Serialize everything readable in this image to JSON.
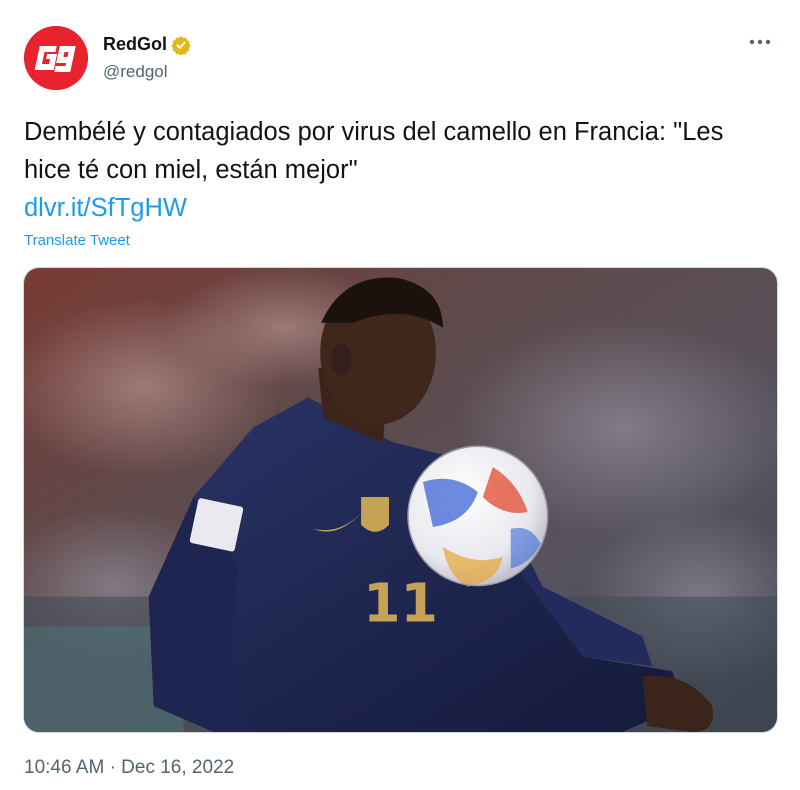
{
  "author": {
    "display_name": "RedGol",
    "handle": "@redgol",
    "verified": true,
    "avatar_icon": "redgol-logo-icon",
    "avatar_color": "#e8232e"
  },
  "tweet": {
    "text": "Dembélé y contagiados por virus del camello en Francia: \"Les hice té con miel, están mejor\"",
    "link": "dlvr.it/SfTgHW",
    "translate_label": "Translate Tweet",
    "image_subject": "soccer player in blue kit controlling a ball",
    "jersey_number": "11"
  },
  "meta": {
    "time": "10:46 AM",
    "separator": "·",
    "date": "Dec 16, 2022"
  },
  "colors": {
    "link": "#1d9bf0",
    "secondary_text": "#536471",
    "verified_badge": "#e2b719"
  },
  "icons": {
    "more": "more-dots-icon",
    "verified": "verified-badge-icon"
  }
}
